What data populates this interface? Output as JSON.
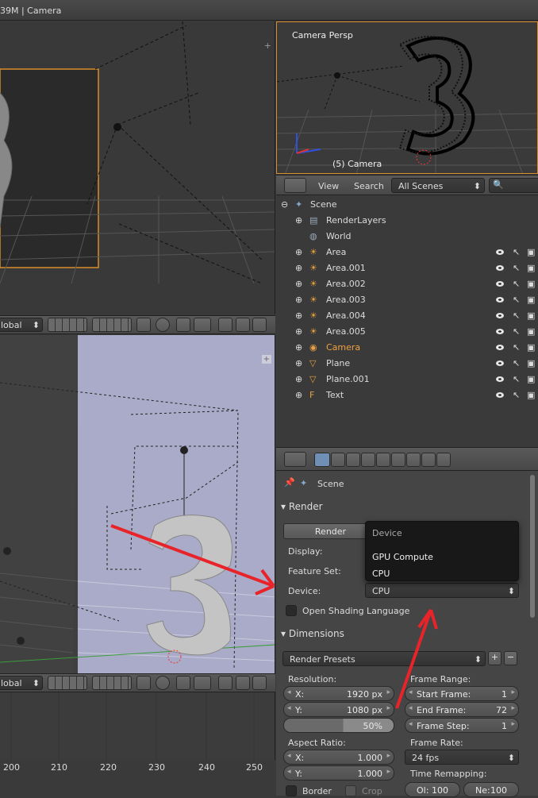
{
  "window": {
    "title": "39M | Camera"
  },
  "vp_top_right": {
    "label": "Camera Persp",
    "object_label": "(5) Camera"
  },
  "view_header": {
    "orientation": "lobal",
    "orientation2": "lobal"
  },
  "outliner": {
    "menu_view": "View",
    "menu_search": "Search",
    "filter": "All Scenes",
    "scene": "Scene",
    "items": [
      {
        "name": "RenderLayers",
        "type": "renderlayers"
      },
      {
        "name": "World",
        "type": "world"
      },
      {
        "name": "Area",
        "type": "lamp"
      },
      {
        "name": "Area.001",
        "type": "lamp"
      },
      {
        "name": "Area.002",
        "type": "lamp"
      },
      {
        "name": "Area.003",
        "type": "lamp"
      },
      {
        "name": "Area.004",
        "type": "lamp"
      },
      {
        "name": "Area.005",
        "type": "lamp"
      },
      {
        "name": "Camera",
        "type": "camera"
      },
      {
        "name": "Plane",
        "type": "mesh"
      },
      {
        "name": "Plane.001",
        "type": "mesh"
      },
      {
        "name": "Text",
        "type": "text"
      }
    ]
  },
  "properties": {
    "breadcrumb": "Scene",
    "render_panel": "Render",
    "render_btn": "Render",
    "display_label": "Display:",
    "feature_label": "Feature Set:",
    "device_label": "Device:",
    "device_value": "CPU",
    "osl_label": "Open Shading Language",
    "dimensions_panel": "Dimensions",
    "presets": "Render Presets",
    "resolution_label": "Resolution:",
    "res_x_label": "X:",
    "res_x": "1920 px",
    "res_y_label": "Y:",
    "res_y": "1080 px",
    "res_pct": "50%",
    "frame_range_label": "Frame Range:",
    "start_label": "Start Frame:",
    "start": "1",
    "end_label": "End Frame:",
    "end": "72",
    "step_label": "Frame Step:",
    "step": "1",
    "aspect_label": "Aspect Ratio:",
    "asp_x_label": "X:",
    "asp_x": "1.000",
    "asp_y_label": "Y:",
    "asp_y": "1.000",
    "frame_rate_label": "Frame Rate:",
    "fps": "24 fps",
    "time_remap_label": "Time Remapping:",
    "old_label": "Ol:",
    "old": "100",
    "new_label": "Ne:",
    "new": "100",
    "border_label": "Border",
    "crop_label": "Crop"
  },
  "popup": {
    "title": "Device",
    "options": [
      "GPU Compute",
      "CPU"
    ]
  },
  "timeline": {
    "ticks": [
      "200",
      "210",
      "220",
      "230",
      "240",
      "250"
    ]
  },
  "colors": {
    "accent": "#d98c2b",
    "arrow": "#e8242a",
    "selected_text": "#f0a040"
  }
}
